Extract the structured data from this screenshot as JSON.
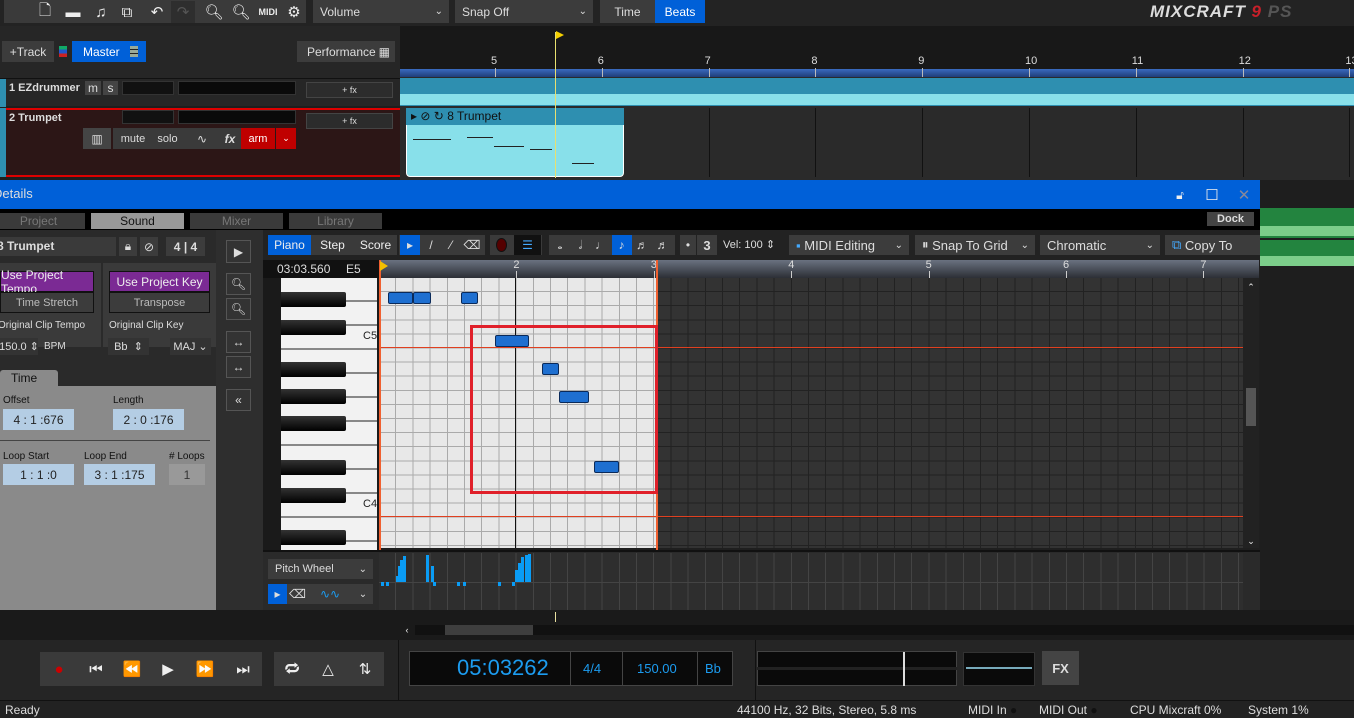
{
  "toolbar": {
    "icons": [
      "new-file-icon",
      "open-folder-icon",
      "open-music-icon",
      "save-icon",
      "split-icon",
      "undo-icon",
      "redo-icon",
      "zoom-in-icon",
      "zoom-out-icon",
      "midi-icon",
      "settings-icon"
    ],
    "midi_label": "MIDI",
    "volume_select": "Volume",
    "snap_select": "Snap Off",
    "time_label": "Time",
    "beats_label": "Beats",
    "logo": "MIXCRAFT 9 PS"
  },
  "tracks_header": {
    "add_track": "+Track",
    "master": "Master",
    "performance": "Performance"
  },
  "timeline": {
    "ticks": [
      "5",
      "6",
      "7",
      "8",
      "9",
      "10",
      "11",
      "12",
      "13"
    ]
  },
  "tracks": [
    {
      "name": "1 EZdrummer",
      "mute": "m",
      "solo": "s",
      "fx": "+ fx"
    },
    {
      "name": "2 Trumpet",
      "fx": "+ fx",
      "mute": "mute",
      "solo": "solo",
      "fx_label": "fx",
      "arm": "arm",
      "clip_name": "8 Trumpet"
    }
  ],
  "details": {
    "title": "Details",
    "tabs": [
      "Project",
      "Sound",
      "Mixer",
      "Library"
    ],
    "active_tab": "Sound",
    "dock": "Dock",
    "clip_name": "8 Trumpet",
    "time_sig_num": "4",
    "time_sig_den": "4",
    "use_project_tempo": "Use Project Tempo",
    "time_stretch": "Time Stretch",
    "original_clip_tempo_label": "Original Clip Tempo",
    "tempo_value": "150.0",
    "bpm": "BPM",
    "use_project_key": "Use Project Key",
    "transpose": "Transpose",
    "original_clip_key_label": "Original Clip Key",
    "key_value": "Bb",
    "scale_value": "MAJ",
    "time_tab": "Time",
    "offset_label": "Offset",
    "offset": "4 : 1 :676",
    "length_label": "Length",
    "length": "2 : 0 :176",
    "loop_start_label": "Loop Start",
    "loop_start": "1 : 1 :0",
    "loop_end_label": "Loop End",
    "loop_end": "3 : 1 :175",
    "loops_label": "# Loops",
    "loops": "1"
  },
  "editor": {
    "modes": [
      "Piano",
      "Step",
      "Score"
    ],
    "active_mode": "Piano",
    "vel_label": "Vel:",
    "velocity": "100",
    "triplet": "3",
    "midi_editing": "MIDI Editing",
    "snap": "Snap To Grid",
    "scale": "Chromatic",
    "copy_to": "Copy To",
    "position": "03:03.560",
    "note": "E5",
    "ruler": [
      "2",
      "3",
      "4",
      "5",
      "6",
      "7"
    ],
    "key_labels": [
      "C5",
      "C4"
    ],
    "controller": "Pitch Wheel",
    "notes": [
      {
        "pitch": "D#5",
        "start": 0.25,
        "len": 0.75
      },
      {
        "pitch": "D#5",
        "start": 1.0,
        "len": 0.5
      },
      {
        "pitch": "D#5",
        "start": 2.375,
        "len": 0.5
      },
      {
        "pitch": "C5",
        "start": 3.375,
        "len": 1.0
      },
      {
        "pitch": "A#4",
        "start": 4.75,
        "len": 0.5
      },
      {
        "pitch": "G#4",
        "start": 5.25,
        "len": 0.875
      },
      {
        "pitch": "D#4",
        "start": 6.25,
        "len": 0.75
      }
    ]
  },
  "transport": {
    "time": "05:03262",
    "signature": "4/4",
    "tempo": "150.00",
    "key": "Bb",
    "fx": "FX"
  },
  "status": {
    "ready": "Ready",
    "audio": "44100 Hz, 32 Bits, Stereo, 5.8 ms",
    "midi_in": "MIDI In",
    "midi_out": "MIDI Out",
    "cpu": "CPU Mixcraft 0%",
    "system": "System 1%"
  },
  "colors": {
    "accent": "#0060d8",
    "arm": "#c00000",
    "purple": "#7b2a94",
    "note": "#1e6fd0",
    "selection": "#e0202a"
  }
}
